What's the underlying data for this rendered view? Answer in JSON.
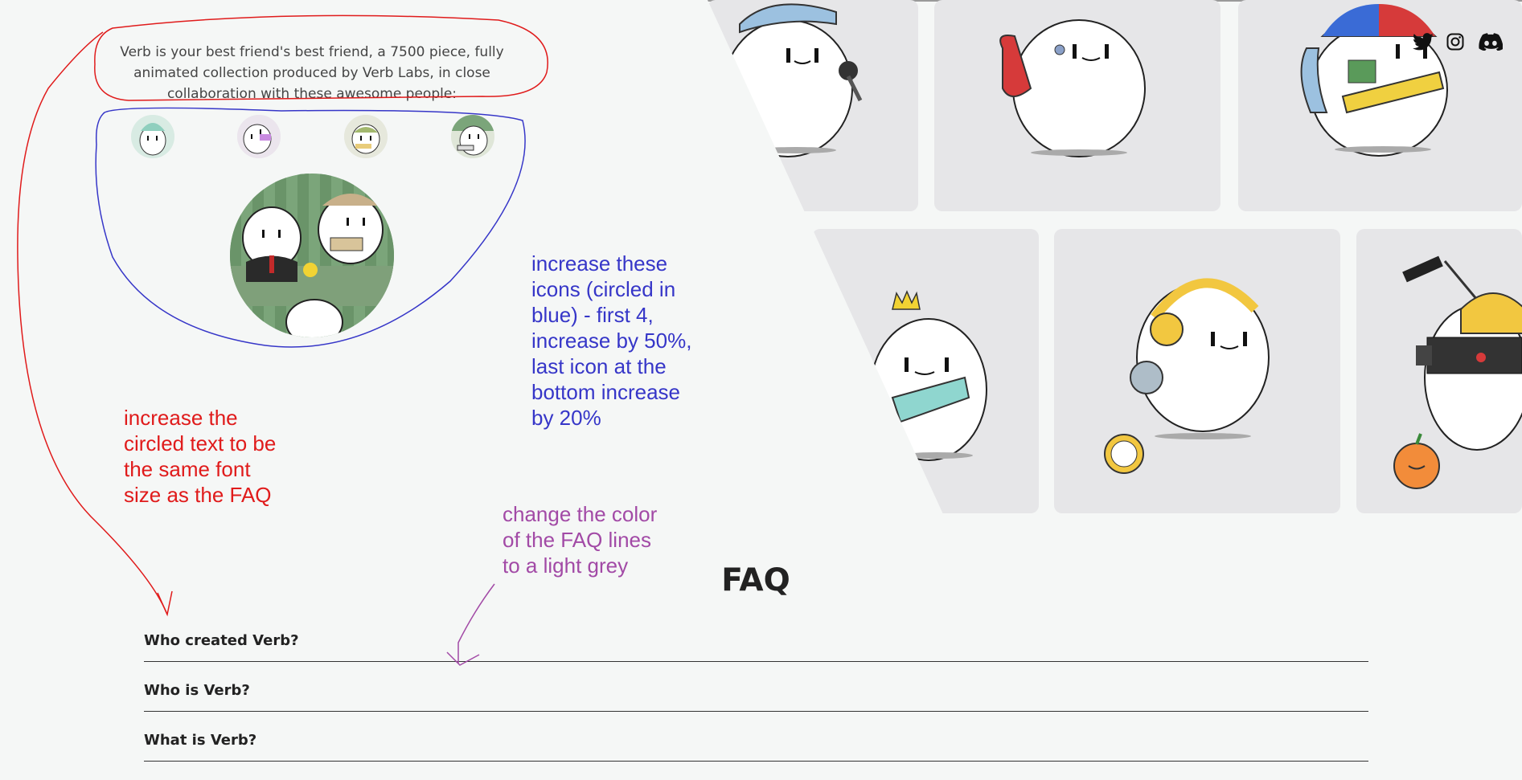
{
  "intro": {
    "text": "Verb is your best friend's best friend, a 7500 piece, fully animated collection produced by Verb Labs, in close collaboration with these awesome people:"
  },
  "team_avatars": [
    "avatar-1",
    "avatar-2",
    "avatar-3",
    "avatar-4",
    "avatar-main"
  ],
  "social": {
    "icons": [
      "twitter-icon",
      "instagram-icon",
      "discord-icon"
    ]
  },
  "gallery": {
    "cards": [
      "blue-cap-camera",
      "red-backpack",
      "propeller-hat-cube",
      "crown-fanny-pack",
      "yellow-headphones-clock",
      "video-camera-orange"
    ]
  },
  "faq": {
    "title": "FAQ",
    "items": [
      "Who created Verb?",
      "Who is Verb?",
      "What is Verb?"
    ]
  },
  "annotations": {
    "blue": "increase these\nicons (circled in\nblue) - first 4,\nincrease by 50%,\nlast icon at the\nbottom increase\nby 20%",
    "red": "increase the\ncircled text to be\nthe same font\nsize as the FAQ",
    "purple": "change the color\nof the FAQ lines\nto a light grey"
  },
  "colors": {
    "background": "#f5f7f6",
    "card": "#e6e6e8",
    "annotation_red": "#e01b1b",
    "annotation_blue": "#3636c8",
    "annotation_purple": "#a24aa6"
  }
}
